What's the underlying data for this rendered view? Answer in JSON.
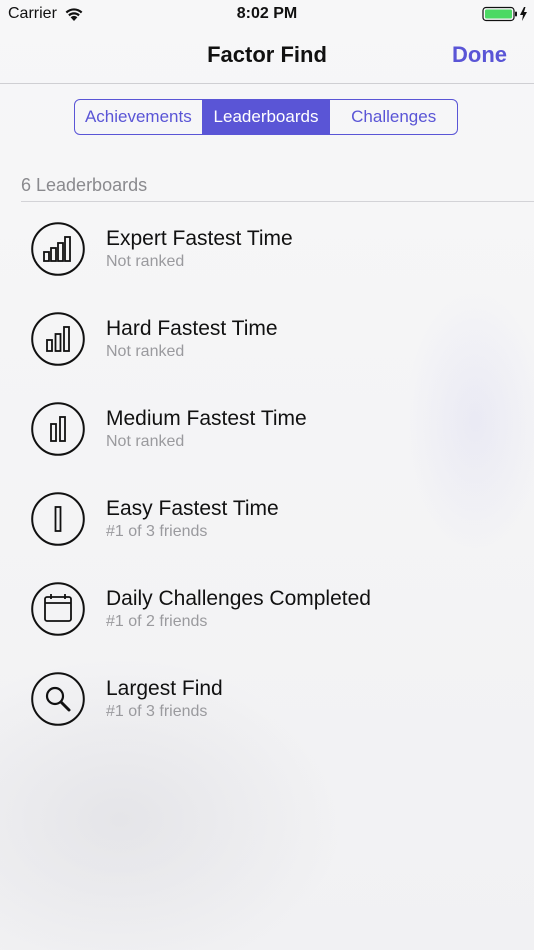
{
  "status_bar": {
    "carrier": "Carrier",
    "time": "8:02 PM"
  },
  "nav": {
    "title": "Factor Find",
    "done_label": "Done"
  },
  "tabs": [
    {
      "label": "Achievements",
      "active": false
    },
    {
      "label": "Leaderboards",
      "active": true
    },
    {
      "label": "Challenges",
      "active": false
    }
  ],
  "section": {
    "header": "6 Leaderboards"
  },
  "leaderboards": [
    {
      "title": "Expert Fastest Time",
      "subtitle": "Not ranked",
      "icon": "bars-four-icon"
    },
    {
      "title": "Hard Fastest Time",
      "subtitle": "Not ranked",
      "icon": "bars-three-icon"
    },
    {
      "title": "Medium Fastest Time",
      "subtitle": "Not ranked",
      "icon": "bars-two-icon"
    },
    {
      "title": "Easy Fastest Time",
      "subtitle": "#1 of 3 friends",
      "icon": "bar-one-icon"
    },
    {
      "title": "Daily Challenges Completed",
      "subtitle": "#1 of 2 friends",
      "icon": "calendar-icon"
    },
    {
      "title": "Largest Find",
      "subtitle": "#1 of 3 friends",
      "icon": "magnifier-icon"
    }
  ],
  "colors": {
    "accent": "#5a55d6",
    "battery": "#4cd964"
  }
}
